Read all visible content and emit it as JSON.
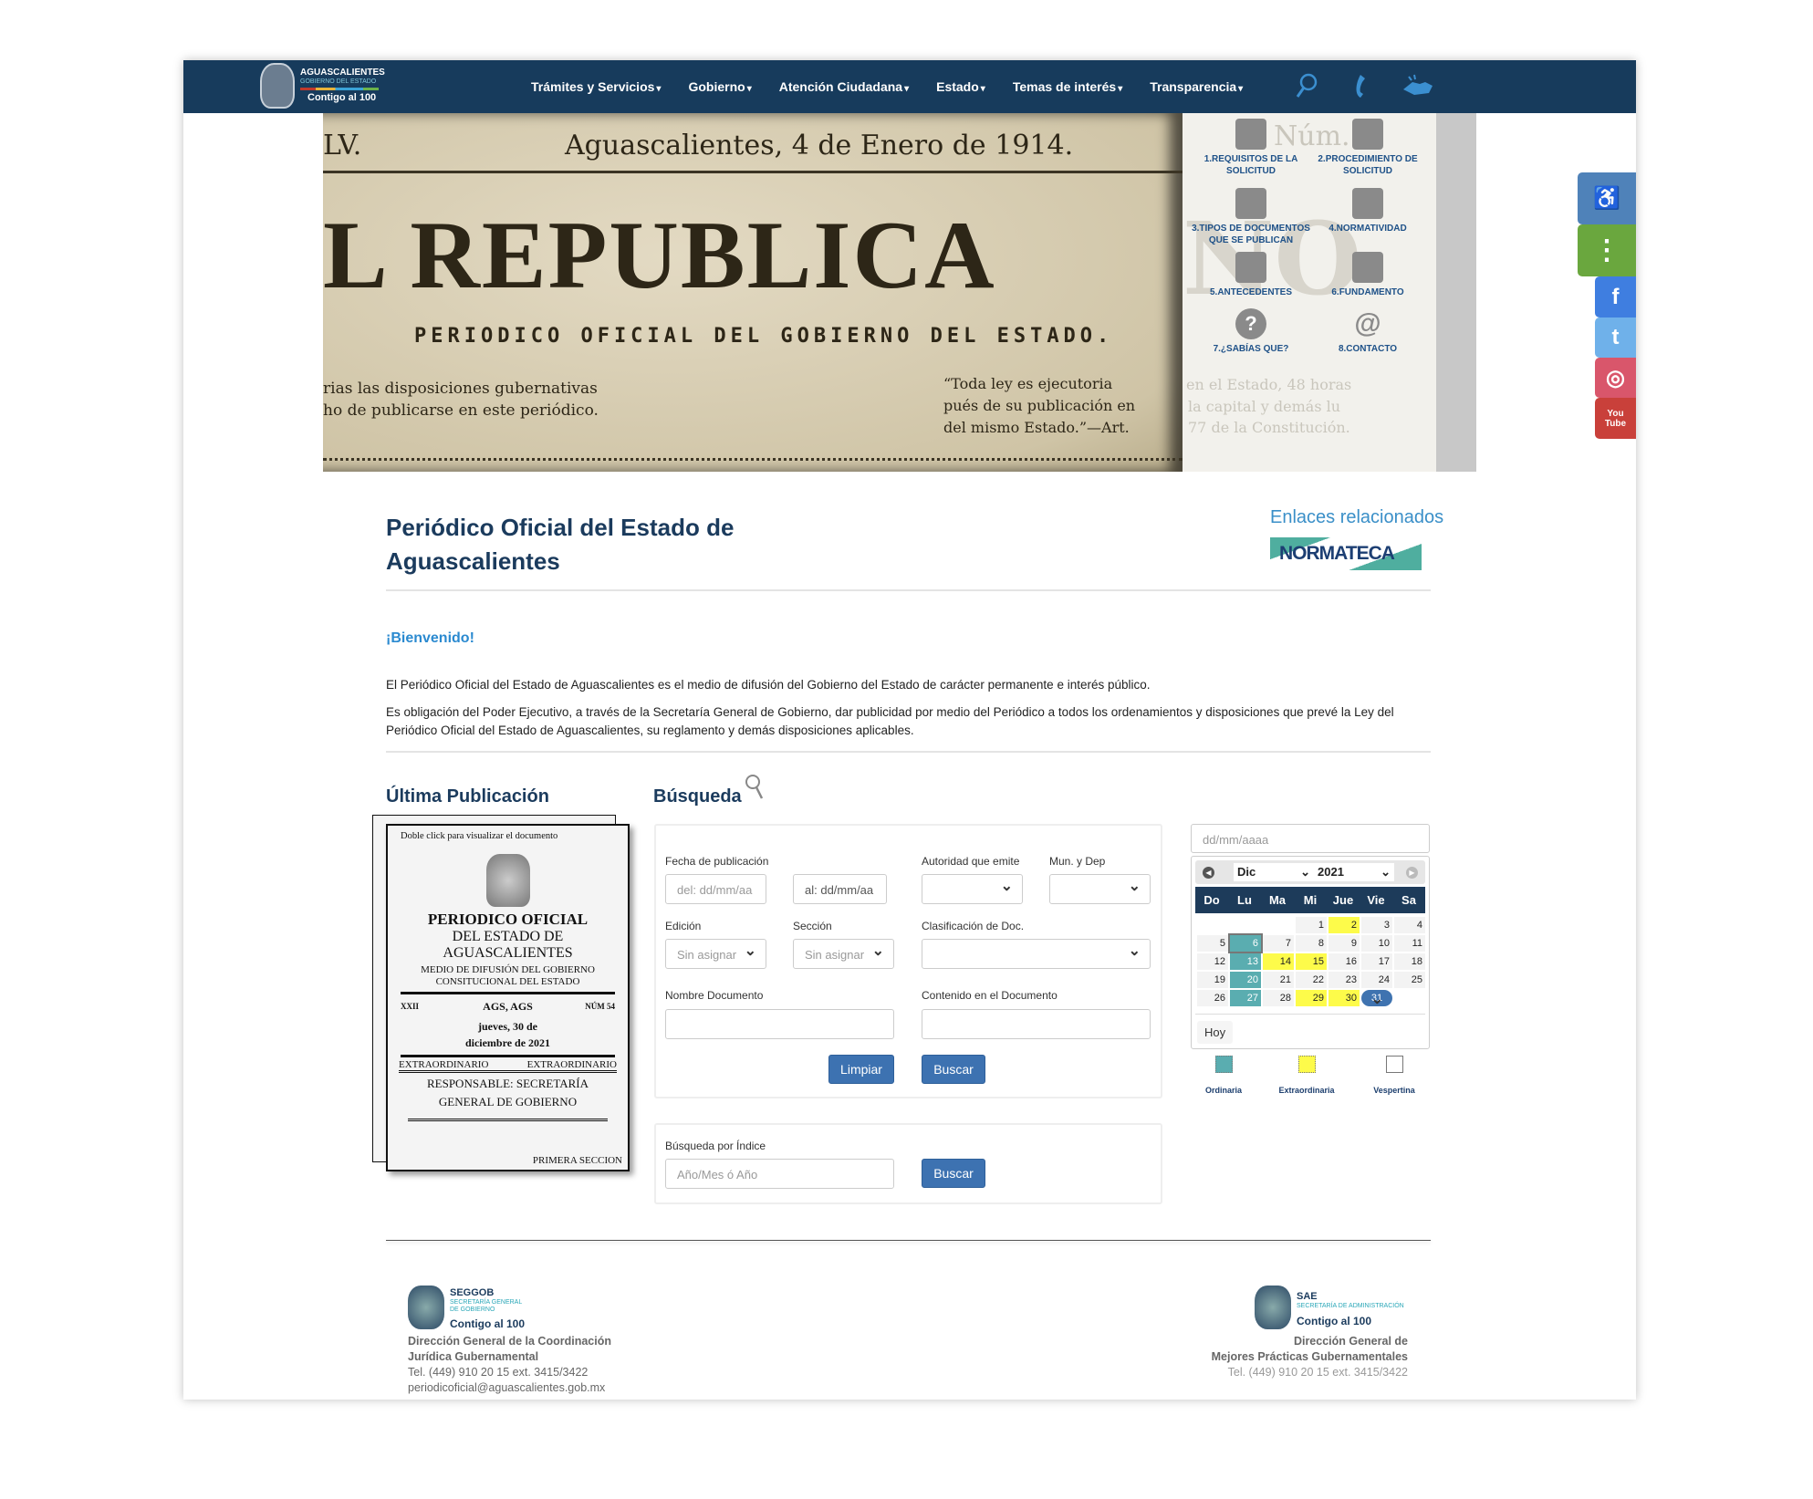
{
  "nav": {
    "logo": {
      "title": "AGUASCALIENTES",
      "subtitle": "GOBIERNO DEL ESTADO",
      "slogan": "Contigo al 100"
    },
    "items": [
      "Trámites y Servicios",
      "Gobierno",
      "Atención Ciudadana",
      "Estado",
      "Temas de interés",
      "Transparencia"
    ],
    "icons": [
      "search-icon",
      "phone-icon",
      "sign-language-icon"
    ]
  },
  "banner": {
    "newspaper": {
      "volume": "LV.",
      "date": "Aguascalientes, 4 de Enero de 1914.",
      "masthead": "L REPUBLICA",
      "subtitle": "PERIODICO OFICIAL DEL GOBIERNO DEL ESTADO.",
      "left_lines": [
        "rias las disposiciones gubernativas",
        "ho de publicarse en este periódico."
      ],
      "right_lines": [
        "“Toda ley es ejecutoria",
        "pués de su publicación en",
        "del mismo Estado.”—Art."
      ],
      "ghost": [
        "Núm. 1",
        "NO",
        "en el Estado, 48 horas",
        "la capital y demás lu",
        "77 de la Constitución."
      ]
    },
    "menu": [
      {
        "label": "1.REQUISITOS DE LA SOLICITUD",
        "icon": "documents-icon"
      },
      {
        "label": "2.PROCEDIMIENTO DE SOLICITUD",
        "icon": "periodico-edit-icon"
      },
      {
        "label": "3.TIPOS DE DOCUMENTOS QUE SE PUBLICAN",
        "icon": "lex-book-icon"
      },
      {
        "label": "4.NORMATIVIDAD",
        "icon": "scales-icon"
      },
      {
        "label": "5.ANTECEDENTES",
        "icon": "records-person-icon"
      },
      {
        "label": "6.FUNDAMENTO",
        "icon": "person-document-icon"
      },
      {
        "label": "7.¿SABÍAS QUE?",
        "icon": "question-bubble-icon"
      },
      {
        "label": "8.CONTACTO",
        "icon": "email-icon"
      }
    ]
  },
  "side": {
    "buttons": [
      "accessibility-icon",
      "more-options-icon",
      "facebook-icon",
      "twitter-icon",
      "instagram-icon",
      "youtube-icon"
    ],
    "colors": [
      "#4f82b9",
      "#6aa73e",
      "#3f7ee0",
      "#6fb1ea",
      "#d9566b",
      "#c9403a"
    ],
    "youtube_text": "You Tube"
  },
  "header": {
    "title": "Periódico Oficial del Estado de Aguascalientes",
    "related": "Enlaces relacionados",
    "normateca": "NORMATECA"
  },
  "welcome": {
    "heading": "¡Bienvenido!",
    "p1": "El Periódico Oficial del Estado de Aguascalientes es el medio de difusión del Gobierno del Estado de carácter permanente e interés público.",
    "p2": "Es obligación del Poder Ejecutivo, a través de la Secretaría General de Gobierno, dar publicidad por medio del Periódico a todos los ordenamientos y disposiciones que prevé la Ley del Periódico Oficial del Estado de Aguascalientes, su reglamento y demás disposiciones aplicables."
  },
  "latest": {
    "heading": "Última Publicación",
    "hint": "Doble click para visualizar el documento",
    "title": "PERIODICO OFICIAL",
    "line2": "DEL ESTADO DE",
    "line3": "AGUASCALIENTES",
    "line4": "MEDIO DE DIFUSIÓN DEL GOBIERNO",
    "line5": "CONSITUCIONAL DEL ESTADO",
    "tomo": "XXII",
    "place": "AGS, AGS",
    "num": "NÚM 54",
    "date": "jueves, 30 de diciembre de 2021",
    "type1": "EXTRAORDINARIO",
    "type2": "EXTRAORDINARIO",
    "resp": "RESPONSABLE: SECRETARÍA GENERAL DE GOBIERNO",
    "section": "PRIMERA SECCION"
  },
  "search": {
    "heading": "Búsqueda",
    "fecha_label": "Fecha de publicación",
    "del_placeholder": "del: dd/mm/aa",
    "al_value": "al: dd/mm/aa",
    "autoridad_label": "Autoridad que emite",
    "mun_label": "Mun. y Dep",
    "edicion_label": "Edición",
    "edicion_value": "Sin asignar",
    "seccion_label": "Sección",
    "seccion_value": "Sin asignar",
    "clasif_label": "Clasificación de Doc.",
    "nombre_label": "Nombre Documento",
    "contenido_label": "Contenido en el Documento",
    "clear": "Limpiar",
    "search": "Buscar",
    "index_label": "Búsqueda por Índice",
    "index_placeholder": "Año/Mes ó Año",
    "index_search": "Buscar"
  },
  "calendar": {
    "placeholder": "dd/mm/aaaa",
    "month": "Dic",
    "year": "2021",
    "dow": [
      "Do",
      "Lu",
      "Ma",
      "Mi",
      "Jue",
      "Vie",
      "Sa"
    ],
    "weeks": [
      [
        null,
        null,
        null,
        {
          "d": 1
        },
        {
          "d": 2,
          "t": "ext"
        },
        {
          "d": 3
        },
        {
          "d": 4
        }
      ],
      [
        {
          "d": 5
        },
        {
          "d": 6,
          "t": "ord",
          "today": true
        },
        {
          "d": 7
        },
        {
          "d": 8
        },
        {
          "d": 9
        },
        {
          "d": 10
        },
        {
          "d": 11
        }
      ],
      [
        {
          "d": 12
        },
        {
          "d": 13,
          "t": "ord"
        },
        {
          "d": 14,
          "t": "ext"
        },
        {
          "d": 15,
          "t": "ext"
        },
        {
          "d": 16
        },
        {
          "d": 17
        },
        {
          "d": 18
        }
      ],
      [
        {
          "d": 19
        },
        {
          "d": 20,
          "t": "ord"
        },
        {
          "d": 21
        },
        {
          "d": 22
        },
        {
          "d": 23
        },
        {
          "d": 24
        },
        {
          "d": 25
        }
      ],
      [
        {
          "d": 26
        },
        {
          "d": 27,
          "t": "ord"
        },
        {
          "d": 28
        },
        {
          "d": 29,
          "t": "ext"
        },
        {
          "d": 30,
          "t": "ext"
        },
        {
          "d": 31,
          "t": "sel"
        },
        null
      ]
    ],
    "today": "Hoy",
    "legend": [
      {
        "label": "Ordinaria",
        "color": "#5aadb0"
      },
      {
        "label": "Extraordinaria",
        "color": "#fdfb4a"
      },
      {
        "label": "Vespertina",
        "color": "#ffffff"
      }
    ]
  },
  "footer": {
    "left": {
      "org": "SEGGOB",
      "org_full": "SECRETARÍA GENERAL DE GOBIERNO",
      "slogan": "Contigo al 100",
      "l1": "Dirección General de la Coordinación",
      "l2": "Jurídica Gubernamental",
      "tel": "Tel. (449) 910 20 15 ext. 3415/3422",
      "email": "periodicoficial@aguascalientes.gob.mx"
    },
    "right": {
      "org": "SAE",
      "org_full": "SECRETARÍA DE ADMINISTRACIÓN",
      "slogan": "Contigo al 100",
      "l1": "Dirección General de",
      "l2": "Mejores Prácticas Gubernamentales",
      "tel": "Tel. (449) 910 20 15 ext. 3415/3422"
    }
  }
}
